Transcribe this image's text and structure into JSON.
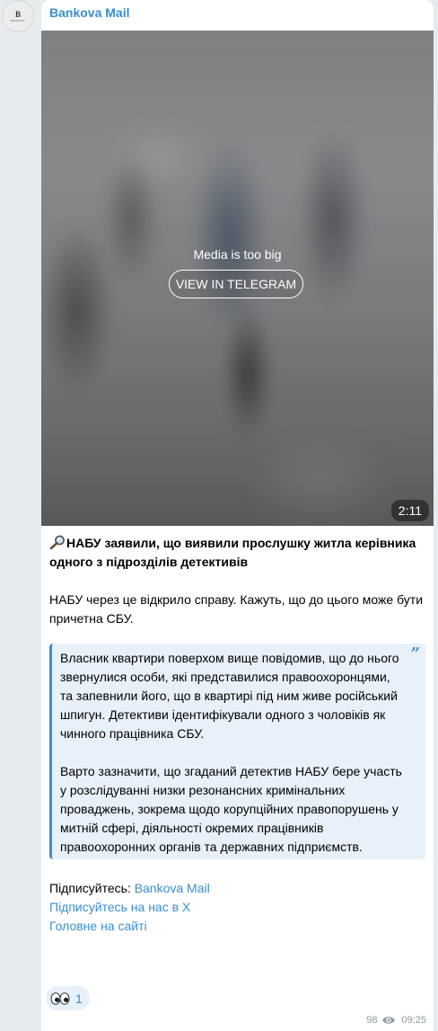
{
  "avatar": {
    "letter": "B",
    "caption": "BANKOVA"
  },
  "channel": {
    "name": "Bankova Mail"
  },
  "media": {
    "notice": "Media is too big",
    "button_label": "VIEW IN TELEGRAM",
    "duration": "2:11"
  },
  "post": {
    "headline": "НАБУ заявили, що виявили прослушку житла керівника одного з підрозділів детективів",
    "paragraph": "НАБУ через це відкрило справу. Кажуть, що до цього може бути причетна СБУ.",
    "quote": {
      "paragraph_1": "Власник квартири поверхом вище повідомив, що до нього звернулися особи, які представилися правоохоронцями, та запевнили його, що в квартирі під ним живе російський шпигун. Детективи ідентифікували одного з чоловіків як чинного працівника СБУ.",
      "paragraph_2": "Варто зазначити, що згаданий детектив НАБУ бере участь у розслідуванні низки резонансних кримінальних проваджень, зокрема щодо корупційних правопорушень у митній сфері, діяльності окремих працівників правоохоронних органів та державних підприємств."
    },
    "subscribe_prefix": "Підписуйтесь: ",
    "subscribe_link": "Bankova Mail",
    "x_link": "Підписуйтесь на нас в X",
    "site_link": "Головне на сайті"
  },
  "reaction": {
    "icon": "eyes-icon",
    "count": "1"
  },
  "footer": {
    "views": "98",
    "time": "09:25"
  },
  "colors": {
    "accent": "#3a8ed0",
    "quote_bg": "#e8f1fa",
    "page_bg": "#e6ebee",
    "meta_text": "#8e9aa3"
  }
}
